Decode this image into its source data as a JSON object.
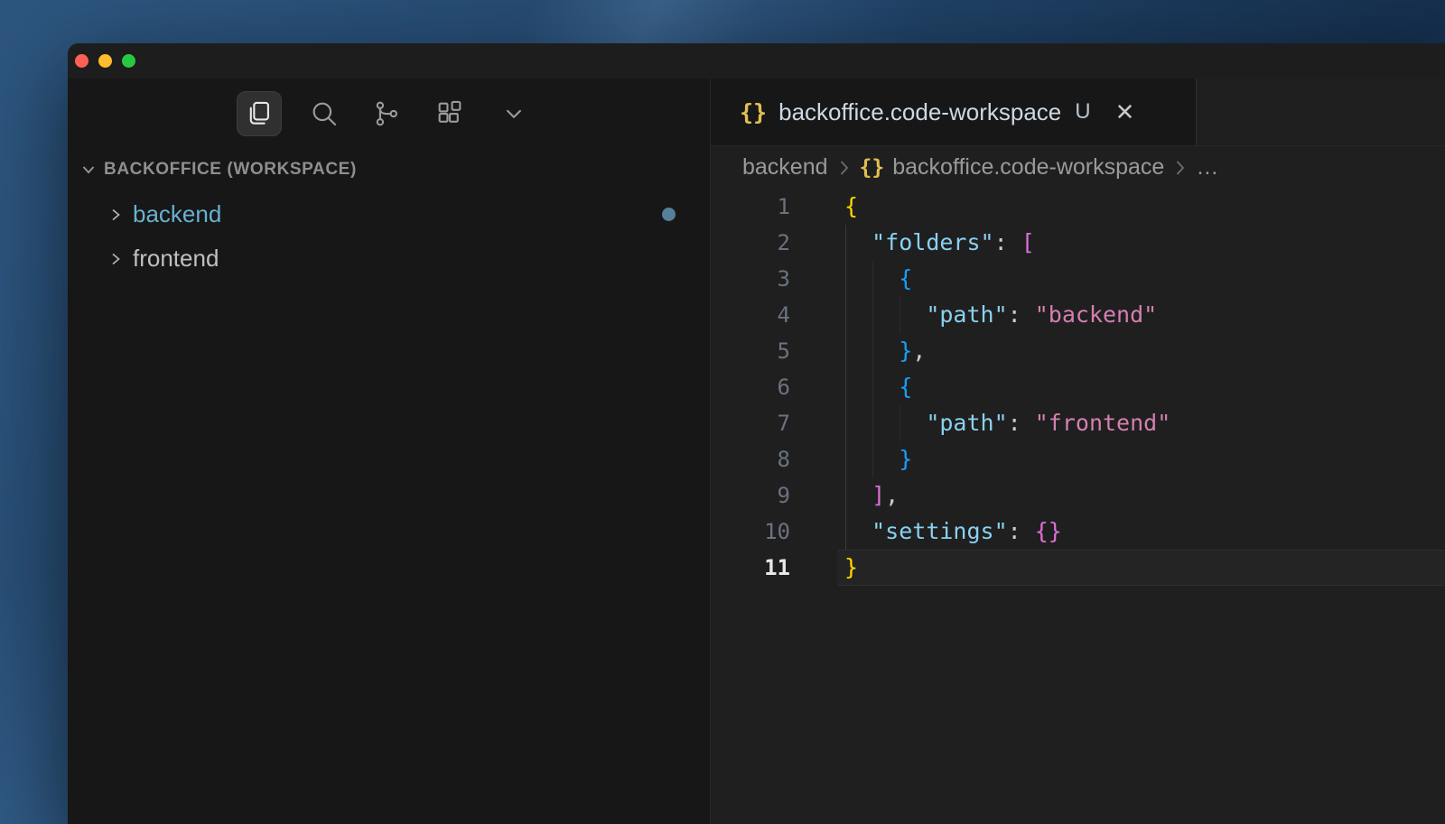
{
  "window": {
    "traffic_lights": [
      {
        "name": "close",
        "color": "#ff5f57"
      },
      {
        "name": "minimize",
        "color": "#febc2e"
      },
      {
        "name": "zoom",
        "color": "#28c840"
      }
    ]
  },
  "activity_bar": {
    "items": [
      {
        "icon": "explorer-icon",
        "label": "Explorer",
        "active": true
      },
      {
        "icon": "search-icon",
        "label": "Search",
        "active": false
      },
      {
        "icon": "source-control-icon",
        "label": "Source Control",
        "active": false
      },
      {
        "icon": "extensions-icon",
        "label": "Extensions",
        "active": false
      },
      {
        "icon": "chevron-down-icon",
        "label": "More Views",
        "active": false
      }
    ]
  },
  "sidebar": {
    "section_header": "BACKOFFICE (WORKSPACE)",
    "items": [
      {
        "label": "backend",
        "color": "#69b0cf",
        "badge_dot": true,
        "dot_color": "#567f99"
      },
      {
        "label": "frontend",
        "color": "#c0c0c0",
        "badge_dot": false,
        "dot_color": ""
      }
    ]
  },
  "editor": {
    "tab": {
      "icon": "json-braces-icon",
      "icon_glyph": "{}",
      "label": "backoffice.code-workspace",
      "git_status": "U",
      "close_glyph": "✕"
    },
    "breadcrumbs": [
      {
        "label": "backend",
        "icon_glyph": ""
      },
      {
        "label": "backoffice.code-workspace",
        "icon_glyph": "{}"
      },
      {
        "label": "…",
        "icon_glyph": ""
      }
    ],
    "syntax_colors": {
      "b1": "#ffd700",
      "b2": "#da70d6",
      "b3": "#179fff",
      "key": "#8ad1f0",
      "str": "#d57fb2",
      "pln": "#cccccc"
    },
    "code": {
      "language": "jsonc",
      "active_line": 11,
      "lines": [
        {
          "num": 1,
          "tokens": [
            [
              "b1",
              "{"
            ]
          ]
        },
        {
          "num": 2,
          "tokens": [
            [
              "pln",
              "  "
            ],
            [
              "key",
              "\"folders\""
            ],
            [
              "pln",
              ": "
            ],
            [
              "b2",
              "["
            ]
          ]
        },
        {
          "num": 3,
          "tokens": [
            [
              "pln",
              "    "
            ],
            [
              "b3",
              "{"
            ]
          ]
        },
        {
          "num": 4,
          "tokens": [
            [
              "pln",
              "      "
            ],
            [
              "key",
              "\"path\""
            ],
            [
              "pln",
              ": "
            ],
            [
              "str",
              "\"backend\""
            ]
          ]
        },
        {
          "num": 5,
          "tokens": [
            [
              "pln",
              "    "
            ],
            [
              "b3",
              "}"
            ],
            [
              "pln",
              ","
            ]
          ]
        },
        {
          "num": 6,
          "tokens": [
            [
              "pln",
              "    "
            ],
            [
              "b3",
              "{"
            ]
          ]
        },
        {
          "num": 7,
          "tokens": [
            [
              "pln",
              "      "
            ],
            [
              "key",
              "\"path\""
            ],
            [
              "pln",
              ": "
            ],
            [
              "str",
              "\"frontend\""
            ]
          ]
        },
        {
          "num": 8,
          "tokens": [
            [
              "pln",
              "    "
            ],
            [
              "b3",
              "}"
            ]
          ]
        },
        {
          "num": 9,
          "tokens": [
            [
              "pln",
              "  "
            ],
            [
              "b2",
              "]"
            ],
            [
              "pln",
              ","
            ]
          ]
        },
        {
          "num": 10,
          "tokens": [
            [
              "pln",
              "  "
            ],
            [
              "key",
              "\"settings\""
            ],
            [
              "pln",
              ": "
            ],
            [
              "b2",
              "{}"
            ]
          ]
        },
        {
          "num": 11,
          "tokens": [
            [
              "b1",
              "}"
            ]
          ]
        }
      ]
    }
  }
}
